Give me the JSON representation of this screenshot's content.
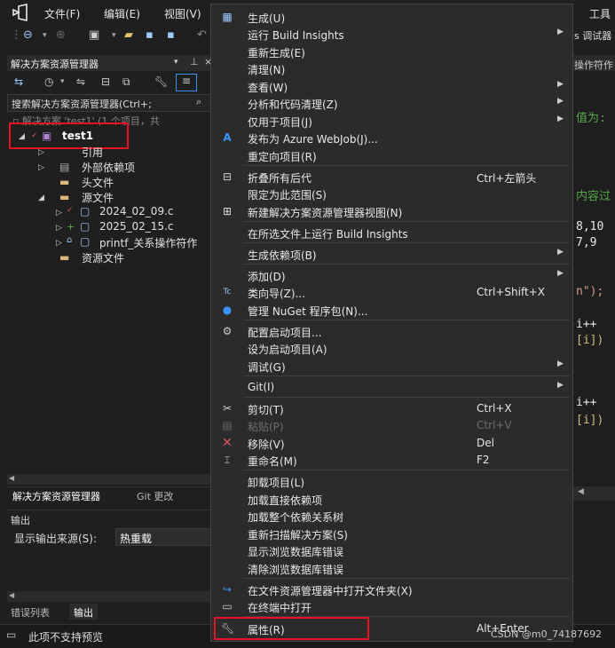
{
  "menubar": {
    "file": "文件(F)",
    "edit": "编辑(E)",
    "view": "视图(V)",
    "tools": "工具"
  },
  "right_panel": {
    "tab_fragment": "s 调试器",
    "subtab_fragment": "操作符作"
  },
  "solution_explorer": {
    "title": "解决方案资源管理器",
    "search_placeholder": "搜索解决方案资源管理器(Ctrl+;",
    "solution_label": "解决方案 'test1' (1 个项目，共",
    "project": "test1",
    "items": {
      "references": "引用",
      "external_deps": "外部依赖项",
      "header_files": "头文件",
      "source_files": "源文件",
      "file1": "2024_02_09.c",
      "file2": "2025_02_15.c",
      "file3": "printf_关系操作符作",
      "resource_files": "资源文件"
    },
    "tabs": {
      "explorer": "解决方案资源管理器",
      "git": "Git 更改"
    }
  },
  "output": {
    "title": "输出",
    "source_label": "显示输出来源(S):",
    "source_value": "热重载"
  },
  "bottom_tabs": {
    "errors": "错误列表",
    "output": "输出"
  },
  "status": {
    "text": "此项不支持预览"
  },
  "editor": {
    "line1": "值为:",
    "line2": "内容过",
    "line3": "8,10",
    "line4": "7,9",
    "line5": "n\");",
    "line6": "i++",
    "line7": "[i])",
    "line8": "i++",
    "line9": "[i])"
  },
  "context_menu": {
    "build": "生成(U)",
    "run_build_insights": "运行 Build Insights",
    "rebuild": "重新生成(E)",
    "clean": "清理(N)",
    "view": "查看(W)",
    "analyze": "分析和代码清理(Z)",
    "project_only": "仅用于项目(J)",
    "publish_azure": "发布为 Azure WebJob(J)...",
    "retarget": "重定向项目(R)",
    "collapse_all": "折叠所有后代",
    "collapse_all_shortcut": "Ctrl+左箭头",
    "scope_to_this": "限定为此范围(S)",
    "new_view": "新建解决方案资源管理器视图(N)",
    "run_build_insights_selected": "在所选文件上运行 Build Insights",
    "build_dependencies": "生成依赖项(B)",
    "add": "添加(D)",
    "class_wizard": "类向导(Z)...",
    "class_wizard_shortcut": "Ctrl+Shift+X",
    "manage_nuget": "管理 NuGet 程序包(N)...",
    "configure_startup": "配置启动项目...",
    "set_startup": "设为启动项目(A)",
    "debug": "调试(G)",
    "git": "Git(I)",
    "cut": "剪切(T)",
    "cut_shortcut": "Ctrl+X",
    "paste": "粘贴(P)",
    "paste_shortcut": "Ctrl+V",
    "remove": "移除(V)",
    "remove_shortcut": "Del",
    "rename": "重命名(M)",
    "rename_shortcut": "F2",
    "unload": "卸载项目(L)",
    "load_direct_deps": "加载直接依赖项",
    "load_dep_tree": "加载整个依赖关系树",
    "rescan": "重新扫描解决方案(S)",
    "show_browse_errors": "显示浏览数据库错误",
    "clear_browse_errors": "清除浏览数据库错误",
    "open_in_explorer": "在文件资源管理器中打开文件夹(X)",
    "open_in_terminal": "在终端中打开",
    "properties": "属性(R)",
    "properties_shortcut": "Alt+Enter"
  },
  "watermark": "CSDN @m0_74187692",
  "colors": {
    "highlight_red": "#e81123",
    "menu_bg": "#2b2b2b",
    "accent_blue": "#3794ff",
    "code_green": "#57a64a",
    "code_gold": "#d7ba7d"
  }
}
